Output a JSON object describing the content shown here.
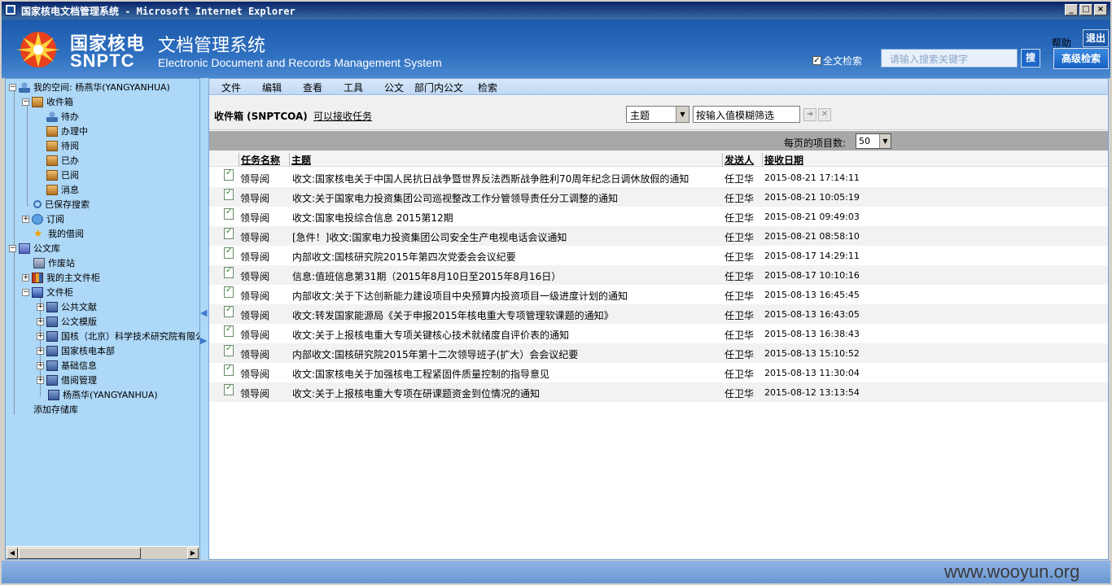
{
  "window": {
    "title": "国家核电文档管理系统 - Microsoft Internet Explorer"
  },
  "header": {
    "logo_cn": "国家核电",
    "logo_en": "SNPTC",
    "system_cn": "文档管理系统",
    "system_en": "Electronic Document and Records Management System",
    "help": "帮助",
    "exit": "退出",
    "fulltext_label": "全文检索",
    "search_placeholder": "请输入搜索关键字",
    "search_button": "搜",
    "advanced_button": "高级检索"
  },
  "tree": [
    {
      "label": "我的空间: 杨燕华(YANGYANHUA)",
      "icon": "user-space-icon"
    },
    {
      "label": "收件箱",
      "icon": "inbox-icon"
    },
    {
      "label": "待办",
      "icon": "person-icon"
    },
    {
      "label": "办理中",
      "icon": "box-icon"
    },
    {
      "label": "待阅",
      "icon": "box-icon"
    },
    {
      "label": "已办",
      "icon": "box-icon"
    },
    {
      "label": "已阅",
      "icon": "box-icon"
    },
    {
      "label": "消息",
      "icon": "box-icon"
    },
    {
      "label": "已保存搜索",
      "icon": "search-icon"
    },
    {
      "label": "订阅",
      "icon": "subscribe-icon"
    },
    {
      "label": "我的借阅",
      "icon": "star-icon"
    },
    {
      "label": "公文库",
      "icon": "database-icon"
    },
    {
      "label": "作废站",
      "icon": "recycle-icon"
    },
    {
      "label": "我的主文件柜",
      "icon": "cabinet-icon"
    },
    {
      "label": "文件柜",
      "icon": "cabinet-icon"
    },
    {
      "label": "公共文献",
      "icon": "library-icon"
    },
    {
      "label": "公文模版",
      "icon": "library-icon"
    },
    {
      "label": "国核（北京）科学技术研究院有限公",
      "icon": "library-icon"
    },
    {
      "label": "国家核电本部",
      "icon": "library-icon"
    },
    {
      "label": "基础信息",
      "icon": "library-icon"
    },
    {
      "label": "借阅管理",
      "icon": "library-icon"
    },
    {
      "label": "杨燕华(YANGYANHUA)",
      "icon": "library-icon"
    },
    {
      "label": "添加存储库",
      "icon": ""
    }
  ],
  "menu": [
    "文件",
    "编辑",
    "查看",
    "工具",
    "公文",
    "部门内公文",
    "检索"
  ],
  "toolbar": {
    "title": "收件箱 (SNPTCOA)",
    "link": "可以接收任务",
    "field_select": "主题",
    "filter_value": "按输入值模糊筛选"
  },
  "pager": {
    "label": "每页的项目数:",
    "value": "50"
  },
  "table": {
    "headers": [
      "任务名称",
      "主题",
      "发送人",
      "接收日期"
    ],
    "rows": [
      {
        "task": "领导阅",
        "subject": "收文:国家核电关于中国人民抗日战争暨世界反法西斯战争胜利70周年纪念日调休放假的通知",
        "sender": "任卫华",
        "date": "2015-08-21 17:14:11"
      },
      {
        "task": "领导阅",
        "subject": "收文:关于国家电力投资集团公司巡视整改工作分管领导责任分工调整的通知",
        "sender": "任卫华",
        "date": "2015-08-21 10:05:19"
      },
      {
        "task": "领导阅",
        "subject": "收文:国家电投综合信息 2015第12期",
        "sender": "任卫华",
        "date": "2015-08-21 09:49:03"
      },
      {
        "task": "领导阅",
        "subject": "[急件！]收文:国家电力投资集团公司安全生产电视电话会议通知",
        "sender": "任卫华",
        "date": "2015-08-21 08:58:10"
      },
      {
        "task": "领导阅",
        "subject": "内部收文:国核研究院2015年第四次党委会会议纪要",
        "sender": "任卫华",
        "date": "2015-08-17 14:29:11"
      },
      {
        "task": "领导阅",
        "subject": "信息:值班信息第31期（2015年8月10日至2015年8月16日）",
        "sender": "任卫华",
        "date": "2015-08-17 10:10:16"
      },
      {
        "task": "领导阅",
        "subject": "内部收文:关于下达创新能力建设项目中央预算内投资项目一级进度计划的通知",
        "sender": "任卫华",
        "date": "2015-08-13 16:45:45"
      },
      {
        "task": "领导阅",
        "subject": "收文:转发国家能源局《关于申报2015年核电重大专项管理软课题的通知》",
        "sender": "任卫华",
        "date": "2015-08-13 16:43:05"
      },
      {
        "task": "领导阅",
        "subject": "收文:关于上报核电重大专项关键核心技术就绪度自评价表的通知",
        "sender": "任卫华",
        "date": "2015-08-13 16:38:43"
      },
      {
        "task": "领导阅",
        "subject": "内部收文:国核研究院2015年第十二次领导班子(扩大）会会议纪要",
        "sender": "任卫华",
        "date": "2015-08-13 15:10:52"
      },
      {
        "task": "领导阅",
        "subject": "收文:国家核电关于加强核电工程紧固件质量控制的指导意见",
        "sender": "任卫华",
        "date": "2015-08-13 11:30:04"
      },
      {
        "task": "领导阅",
        "subject": "收文:关于上报核电重大专项在研课题资金到位情况的通知",
        "sender": "任卫华",
        "date": "2015-08-12 13:13:54"
      }
    ]
  },
  "watermark": "www.wooyun.org"
}
